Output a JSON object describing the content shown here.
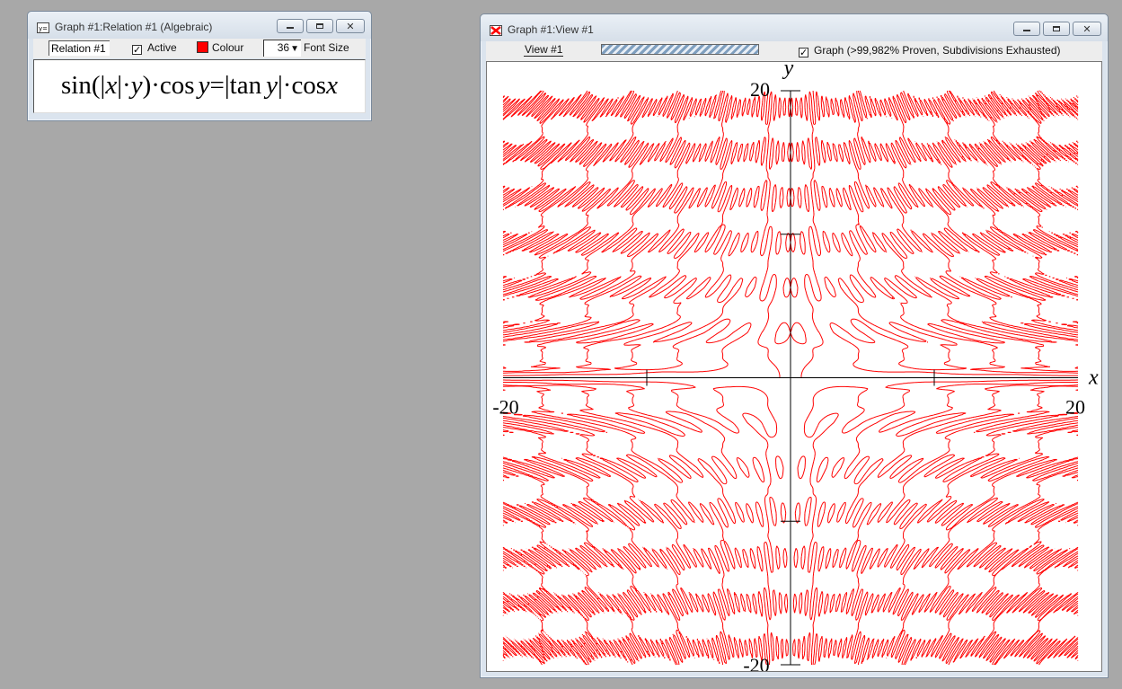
{
  "desktop": {
    "background": "#a8a8a8"
  },
  "relation_window": {
    "title": "Graph #1:Relation #1 (Algebraic)",
    "name_field_value": "Relation #1",
    "active_label": "Active",
    "active_checked": true,
    "colour_label": "Colour",
    "colour_value": "#ff0000",
    "font_size_value": "36",
    "font_size_arrow": "▼",
    "font_size_label": "Font Size",
    "equation": {
      "sin": "sin",
      "lparen": "(",
      "abs_open": "|",
      "x1": "x",
      "abs_close": "|",
      "dot1": "·",
      "y1": "y",
      "rparen": ")",
      "dot2": "·",
      "cos1": "cos",
      "y2": "y",
      "equals": "=",
      "abs2_open": "|",
      "tan": "tan",
      "y3": "y",
      "abs2_close": "|",
      "dot3": "·",
      "cos2": "cos",
      "x2": "x"
    }
  },
  "view_window": {
    "title": "Graph #1:View #1",
    "view_tab_label": "View #1",
    "graph_label": "Graph (>99,982% Proven, Subdivisions Exhausted)",
    "graph_checked": true
  },
  "chart_data": {
    "type": "scatter",
    "relation": "sin(|x|·y)·cos y = |tan y|·cos x",
    "xlim": [
      -20,
      20
    ],
    "ylim": [
      -20,
      20
    ],
    "xlabel": "x",
    "ylabel": "y",
    "x_tick_labels": [
      "-20",
      "20"
    ],
    "y_tick_labels": [
      "20",
      "-20"
    ],
    "curve_color": "#ff0000",
    "grid": false
  }
}
